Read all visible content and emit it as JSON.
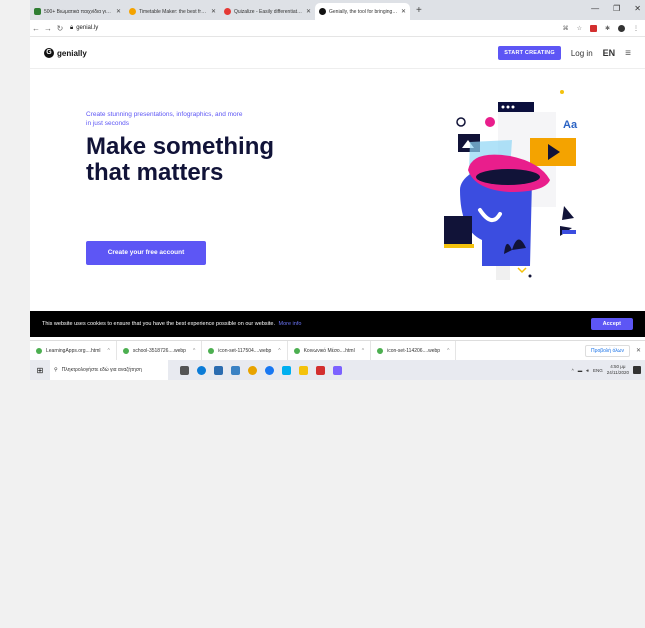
{
  "browser": {
    "tabs": [
      {
        "label": "500+ Βιωματικά παιχνίδια για Mat...",
        "fav_color": "#2e7d32"
      },
      {
        "label": "Timetable Maker: the best free o...",
        "fav_color": "#f4a300"
      },
      {
        "label": "Quizalize - Easily differentiate an...",
        "fav_color": "#e53935"
      },
      {
        "label": "Genially, the tool for bringing yo...",
        "fav_color": "#111111"
      }
    ],
    "new_tab": "+",
    "url": "genial.ly"
  },
  "site": {
    "logo_text": "genially",
    "start_label": "START CREATING",
    "login_label": "Log in",
    "lang_label": "EN"
  },
  "hero": {
    "subtitle": "Create stunning presentations, infographics, and more in just seconds",
    "title_line1": "Make something",
    "title_line2": "that matters",
    "cta_label": "Create your free account"
  },
  "cookie": {
    "text": "This website uses cookies to ensure that you have the best experience possible on our website.",
    "link": "More info",
    "accept": "Accept"
  },
  "downloads": {
    "items": [
      "LearningApps.org....html",
      "school-3518726....webp",
      "icon-set-117504....webp",
      "Κοινωνικό Μέσο....html",
      "icon-set-114206....webp"
    ],
    "show_all": "Προβολή όλων"
  },
  "taskbar": {
    "search_placeholder": "Πληκτρολογήστε εδώ για αναζήτηση",
    "lang": "ENG",
    "time": "4:50 μμ",
    "date": "24/11/2020"
  }
}
